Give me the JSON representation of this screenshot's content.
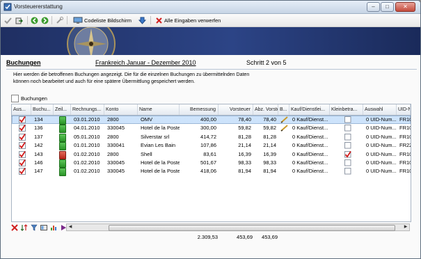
{
  "window": {
    "title": "Vorsteuererstattung"
  },
  "toolbar": {
    "codeliste_label": "Codeliste Bildschirm",
    "verwerfen_label": "Alle Eingaben verwerfen"
  },
  "header": {
    "title": "Buchungen",
    "period": "Frankreich Januar - Dezember 2010",
    "step": "Schritt 2 von 5"
  },
  "description": [
    "Hier werden die betroffenen Buchungen angezeigt. Die für die einzelnen Buchungen zu übermittelnden Daten",
    "können noch bearbeitet und auch für eine spätere Übermittlung gespeichert werden."
  ],
  "group_label": "Buchungen",
  "columns": [
    "Aus...",
    "Buchu...",
    "Zeil...",
    "Rechnungs...",
    "Konto",
    "Name",
    "Bemessung",
    "Vorsteuer",
    "Abz. Vorste...",
    "B...",
    "Kauf/Dienstlei...",
    "Kleinbetra...",
    "Auswahl",
    "UID-N"
  ],
  "rows": [
    {
      "buchung": "134",
      "doc": "green",
      "datum": "03.01.2010",
      "konto": "2800",
      "name": "OMV",
      "bemessung": "400,00",
      "vorsteuer": "78,40",
      "abz": "78,40",
      "pen": true,
      "kauf": "0 Kauf/Dienst...",
      "klein": false,
      "auswahl": "0 UID-Num...",
      "uid": "FR10",
      "selected": true
    },
    {
      "buchung": "136",
      "doc": "green",
      "datum": "04.01.2010",
      "konto": "330045",
      "name": "Hotel de la Poste",
      "bemessung": "300,00",
      "vorsteuer": "59,82",
      "abz": "59,82",
      "pen": true,
      "kauf": "0 Kauf/Dienst...",
      "klein": false,
      "auswahl": "0 UID-Num...",
      "uid": "FR10",
      "selected": false
    },
    {
      "buchung": "137",
      "doc": "green",
      "datum": "05.01.2010",
      "konto": "2800",
      "name": "Silverstar srl",
      "bemessung": "414,72",
      "vorsteuer": "81,28",
      "abz": "81,28",
      "pen": false,
      "kauf": "0 Kauf/Dienst...",
      "klein": false,
      "auswahl": "0 UID-Num...",
      "uid": "FR10",
      "selected": false
    },
    {
      "buchung": "142",
      "doc": "green",
      "datum": "01.01.2010",
      "konto": "330041",
      "name": "Evian Les Bain",
      "bemessung": "107,86",
      "vorsteuer": "21,14",
      "abz": "21,14",
      "pen": false,
      "kauf": "0 Kauf/Dienst...",
      "klein": false,
      "auswahl": "0 UID-Num...",
      "uid": "FR22",
      "selected": false
    },
    {
      "buchung": "143",
      "doc": "red",
      "datum": "01.02.2010",
      "konto": "2800",
      "name": "Shell",
      "bemessung": "83,61",
      "vorsteuer": "16,39",
      "abz": "16,39",
      "pen": false,
      "kauf": "0 Kauf/Dienst...",
      "klein": true,
      "auswahl": "0 UID-Num...",
      "uid": "FR10",
      "selected": false
    },
    {
      "buchung": "146",
      "doc": "green",
      "datum": "01.02.2010",
      "konto": "330045",
      "name": "Hotel de la Poste",
      "bemessung": "501,67",
      "vorsteuer": "98,33",
      "abz": "98,33",
      "pen": false,
      "kauf": "0 Kauf/Dienst...",
      "klein": false,
      "auswahl": "0 UID-Num...",
      "uid": "FR10",
      "selected": false
    },
    {
      "buchung": "147",
      "doc": "green",
      "datum": "01.02.2010",
      "konto": "330045",
      "name": "Hotel de la Poste",
      "bemessung": "418,06",
      "vorsteuer": "81,94",
      "abz": "81,94",
      "pen": false,
      "kauf": "0 Kauf/Dienst...",
      "klein": false,
      "auswahl": "0 UID-Num...",
      "uid": "FR10",
      "selected": false
    }
  ],
  "totals": {
    "bemessung": "2.309,53",
    "vorsteuer": "453,69",
    "abz": "453,69"
  },
  "colors": {
    "banner": "#2c4486",
    "selected_row": "#cde3fb",
    "check": "#d11a1a"
  }
}
